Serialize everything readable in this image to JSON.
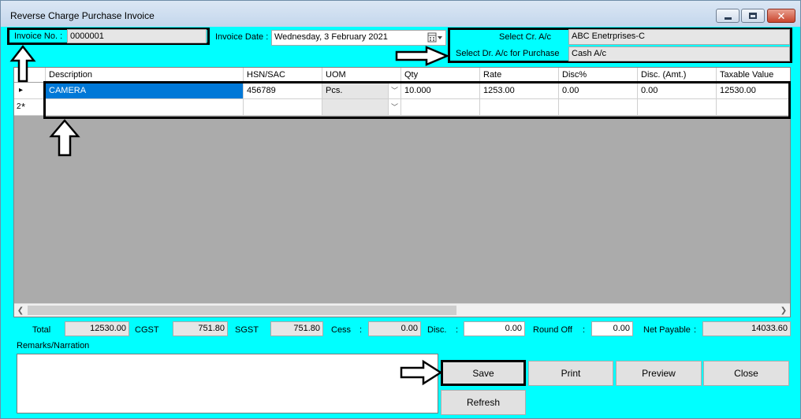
{
  "window": {
    "title": "Reverse Charge Purchase Invoice"
  },
  "header": {
    "invoice_no_label": "Invoice No. :",
    "invoice_no_value": "0000001",
    "invoice_date_label": "Invoice Date :",
    "invoice_date_value": "Wednesday,   3  February  2021",
    "cr_ac_label": "Select Cr. A/c",
    "cr_ac_value": "ABC Enetrprises-C",
    "dr_ac_label": "Select Dr. A/c for Purchase",
    "dr_ac_value": "Cash A/c"
  },
  "grid": {
    "columns": [
      "Description",
      "HSN/SAC",
      "UOM",
      "Qty",
      "Rate",
      "Disc%",
      "Disc. (Amt.)",
      "Taxable Value"
    ],
    "rows": [
      [
        "CAMERA",
        "456789",
        "Pcs.",
        "10.000",
        "1253.00",
        "0.00",
        "0.00",
        "12530.00"
      ]
    ],
    "new_row_marker": "*",
    "row_number": "2",
    "current_row_marker": "▸"
  },
  "totals": {
    "total_label": "Total",
    "total_value": "12530.00",
    "cgst_label": "CGST",
    "cgst_value": "751.80",
    "sgst_label": "SGST",
    "sgst_value": "751.80",
    "cess_label": "Cess",
    "cess_colon": ":",
    "cess_value": "0.00",
    "disc_label": "Disc.",
    "disc_colon": ":",
    "disc_value": "0.00",
    "roundoff_label": "Round Off",
    "roundoff_colon": ":",
    "roundoff_value": "0.00",
    "net_payable_label": "Net Payable",
    "net_payable_colon": ":",
    "net_payable_value": "14033.60"
  },
  "remarks": {
    "label": "Remarks/Narration",
    "value": ""
  },
  "buttons": {
    "save": "Save",
    "print": "Print",
    "preview": "Preview",
    "close": "Close",
    "refresh": "Refresh"
  },
  "icons": {
    "calendar": "calendar-icon",
    "dropdown": "chevron-down-icon"
  },
  "colors": {
    "background": "#00ffff",
    "selection": "#0078d7"
  }
}
